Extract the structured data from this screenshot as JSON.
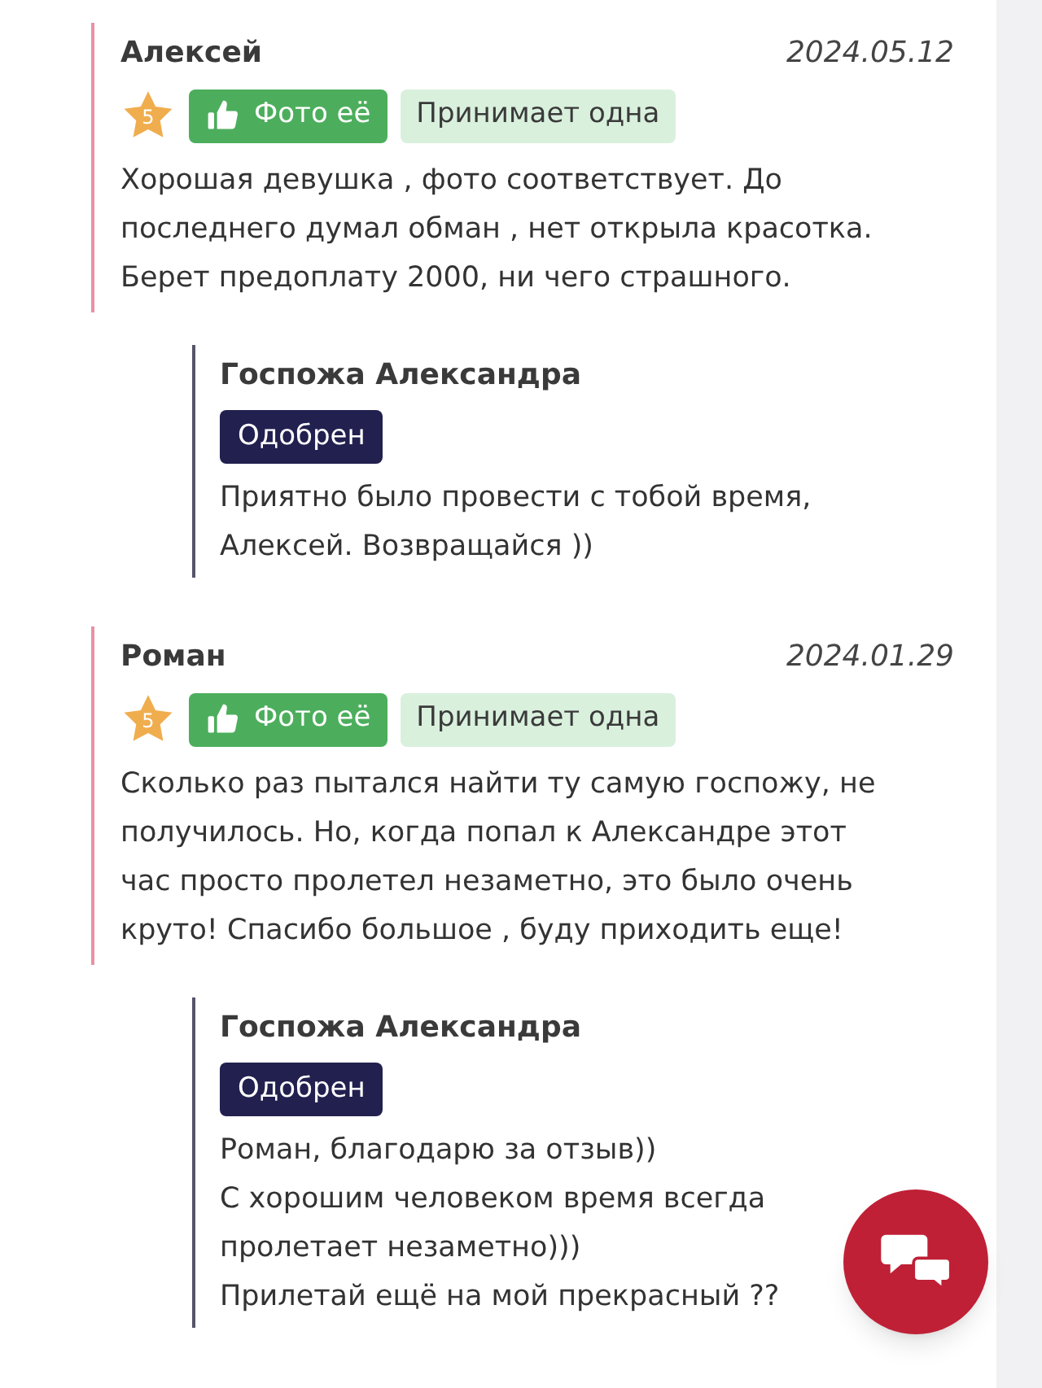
{
  "reviews": [
    {
      "author": "Алексей",
      "date": "2024.05.12",
      "rating": "5",
      "photo_tag": "Фото её",
      "tag": "Принимает одна",
      "text": "Хорошая девушка , фото соответствует. До\nпоследнего думал обман , нет открыла красотка.\nБерет предоплату 2000, ни чего страшного.",
      "reply": {
        "author": "Госпожа Александра",
        "status": "Одобрен",
        "text": "Приятно было провести с тобой время,\nАлексей. Возвращайся ))"
      }
    },
    {
      "author": "Роман",
      "date": "2024.01.29",
      "rating": "5",
      "photo_tag": "Фото её",
      "tag": "Принимает одна",
      "text": "Сколько раз пытался найти ту самую госпожу, не\nполучилось. Но, когда попал к Александре этот\nчас просто пролетел незаметно, это было очень\nкруто! Спасибо большое , буду приходить еще!",
      "reply": {
        "author": "Госпожа Александра",
        "status": "Одобрен",
        "text": "Роман, благодарю за отзыв))\nС хорошим человеком время всегда\nпролетает незаметно)))\nПрилетай ещё на мой прекрасный ??"
      }
    }
  ]
}
